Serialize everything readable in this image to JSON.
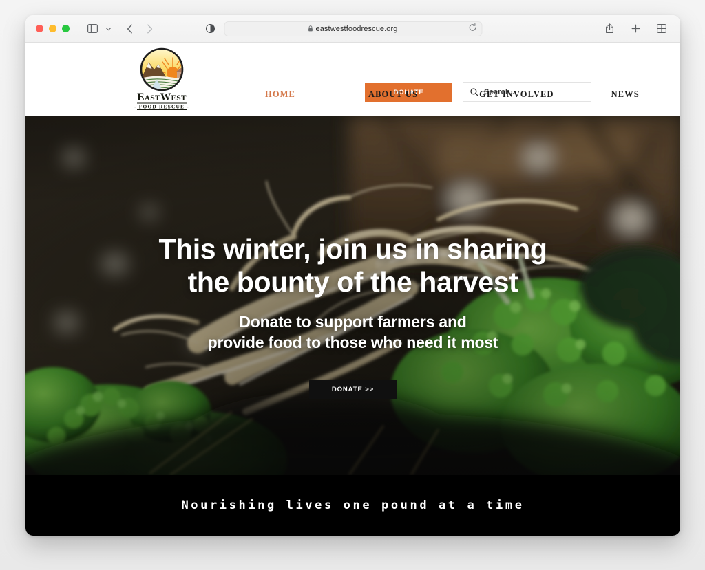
{
  "browser": {
    "traffic_lights": [
      "close",
      "minimize",
      "zoom"
    ],
    "sidebar_icon": "sidebar-icon",
    "chevron_icon": "chevron-down-icon",
    "back_icon": "back-arrow-icon",
    "forward_icon": "forward-arrow-icon",
    "reader_icon": "reader-toggle-icon",
    "lock_icon": "lock-icon",
    "url": "eastwestfoodrescue.org",
    "reload_icon": "reload-icon",
    "share_icon": "share-icon",
    "new_tab_icon": "plus-icon",
    "tab_overview_icon": "tab-overview-icon"
  },
  "site": {
    "logo": {
      "name_line_1": "East",
      "name_line_2": "West",
      "subtitle": "FOOD RESCUE"
    },
    "donate_button": "DONATE",
    "search": {
      "placeholder": "Search...",
      "icon": "search-icon",
      "value": ""
    },
    "nav": [
      {
        "label": "HOME",
        "active": true
      },
      {
        "label": "ABOUT US",
        "active": false
      },
      {
        "label": "GET INVOLVED",
        "active": false
      },
      {
        "label": "NEWS",
        "active": false
      }
    ],
    "hero": {
      "title_line_1": "This winter, join us in sharing",
      "title_line_2": "the bounty of the harvest",
      "subtitle_line_1": "Donate to support farmers and",
      "subtitle_line_2": "provide food to those who need it most",
      "cta": "DONATE >>",
      "image_alt": "Freshly harvested parsnip roots with green parsley in a barn"
    },
    "tagline": "Nourishing lives one pound at a time"
  },
  "colors": {
    "brand_orange": "#e2702e",
    "nav_active": "#d4784a",
    "tagline_bar": "#000000",
    "cta_dark": "#101010"
  }
}
